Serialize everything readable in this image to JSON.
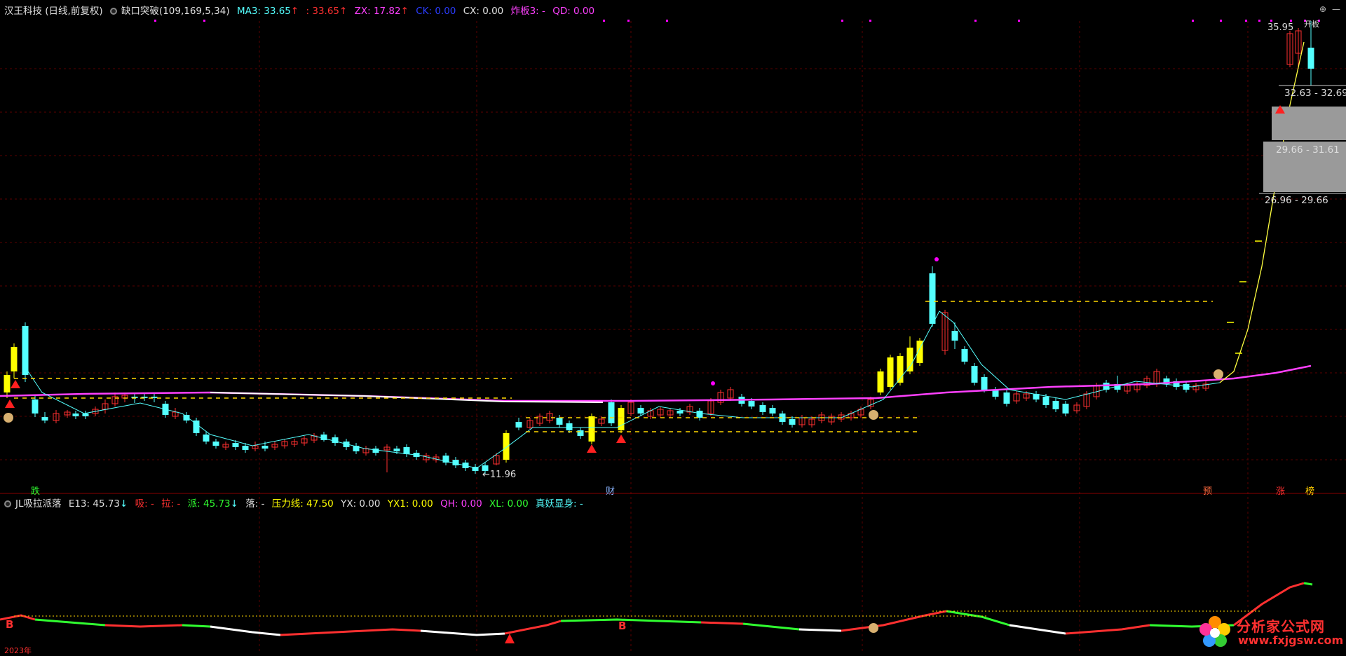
{
  "main_header": {
    "stock": "汉王科技 (日线,前复权)",
    "indicator": "缺口突破(109,169,5,34)",
    "ma3": "MA3: 33.65",
    "ma3_arrow": "↑",
    "sep": ": 33.65",
    "sep_arrow": "↑",
    "zx": "ZX: 17.82",
    "zx_arrow": "↑",
    "ck": "CK: 0.00",
    "cx": "CX: 0.00",
    "zb": "炸板3: -",
    "qd": "QD: 0.00"
  },
  "sub_header": {
    "name": "JL吸拉派落",
    "e13": "E13: 45.73",
    "e13_arrow": "↓",
    "xi": "吸: -",
    "la": "拉: -",
    "pai": "派: 45.73",
    "pai_arrow": "↓",
    "luo": "落: -",
    "yll": "压力线: 47.50",
    "yx": "YX: 0.00",
    "yx1": "YX1: 0.00",
    "qh": "QH: 0.00",
    "xl": "XL: 0.00",
    "zyxs": "真妖显身: -"
  },
  "annotations": {
    "low_price": "←11.96",
    "high_price": "35.95",
    "high_tag": "开板",
    "range1": "32.63 - 32.69",
    "range2": "29.66 - 31.61",
    "range3": "26.96 - 29.66",
    "tag_die": "跌",
    "tag_cai": "财",
    "tag_yu": "预",
    "tag_zhang": "涨",
    "tag_bang": "榜",
    "b1": "B",
    "b2": "B",
    "sub_date_left": "2023年"
  },
  "watermark": {
    "title": "分析家公式网",
    "url": "www.fxjgsw.com"
  },
  "colors": {
    "up": "#ff3030",
    "down": "#54ffff",
    "yellow": "#ffff00",
    "magenta": "#ff00ff",
    "ma_line": "#ff40ff",
    "grid": "#5a0000"
  }
}
